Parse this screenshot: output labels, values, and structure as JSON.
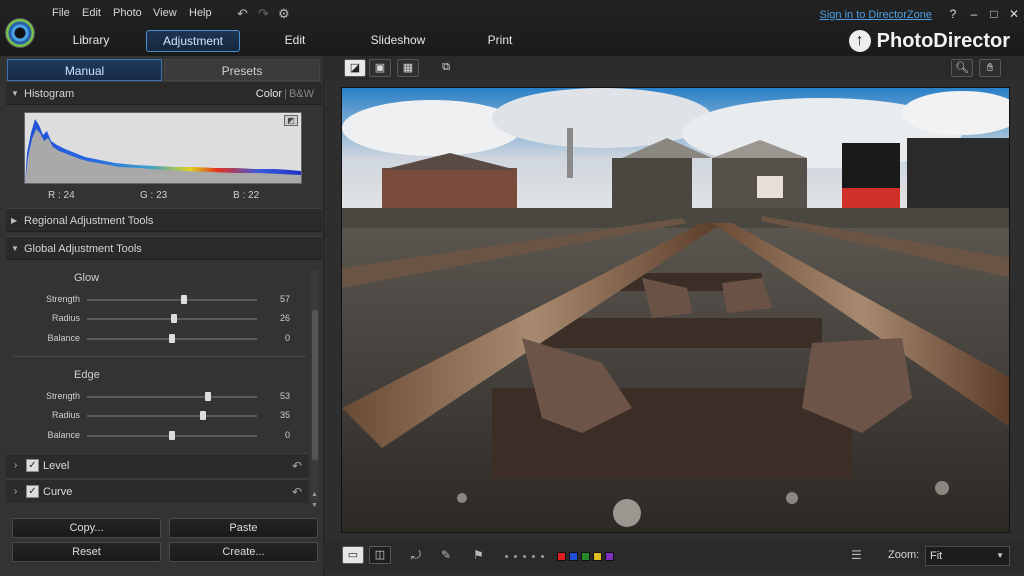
{
  "menu": {
    "file": "File",
    "edit": "Edit",
    "photo": "Photo",
    "view": "View",
    "help": "Help"
  },
  "signin": "Sign in to DirectorZone",
  "window": {
    "help": "?",
    "minimize": "‒",
    "maximize": "□",
    "close": "✕"
  },
  "modes": {
    "library": "Library",
    "adjustment": "Adjustment",
    "edit": "Edit",
    "slideshow": "Slideshow",
    "print": "Print"
  },
  "brand": "PhotoDirector",
  "panel_tabs": {
    "manual": "Manual",
    "presets": "Presets"
  },
  "histogram": {
    "title": "Histogram",
    "color": "Color",
    "separator": "|",
    "bw": "B&W",
    "r": "R : 24",
    "g": "G : 23",
    "b": "B : 22"
  },
  "sections": {
    "regional": "Regional Adjustment Tools",
    "global": "Global Adjustment Tools"
  },
  "glow": {
    "title": "Glow",
    "sliders": [
      {
        "label": "Strength",
        "value": "57",
        "position": 0.57
      },
      {
        "label": "Radius",
        "value": "26",
        "position": 0.51
      },
      {
        "label": "Balance",
        "value": "0",
        "position": 0.5
      }
    ]
  },
  "edge": {
    "title": "Edge",
    "sliders": [
      {
        "label": "Strength",
        "value": "53",
        "position": 0.71
      },
      {
        "label": "Radius",
        "value": "35",
        "position": 0.68
      },
      {
        "label": "Balance",
        "value": "0",
        "position": 0.5
      }
    ]
  },
  "tools": [
    {
      "label": "Level",
      "checked": true
    },
    {
      "label": "Curve",
      "checked": true
    }
  ],
  "buttons": {
    "copy": "Copy...",
    "paste": "Paste",
    "reset": "Reset",
    "create": "Create..."
  },
  "zoom": {
    "label": "Zoom:",
    "value": "Fit"
  },
  "label_colors": [
    "#e02020",
    "#2050d8",
    "#2a8a2a",
    "#e0c020",
    "#8030c0"
  ],
  "icons": {
    "undo": "undo-icon",
    "redo": "redo-icon",
    "settings": "gear-icon",
    "search": "magnifier-icon",
    "hand": "hand-icon"
  }
}
